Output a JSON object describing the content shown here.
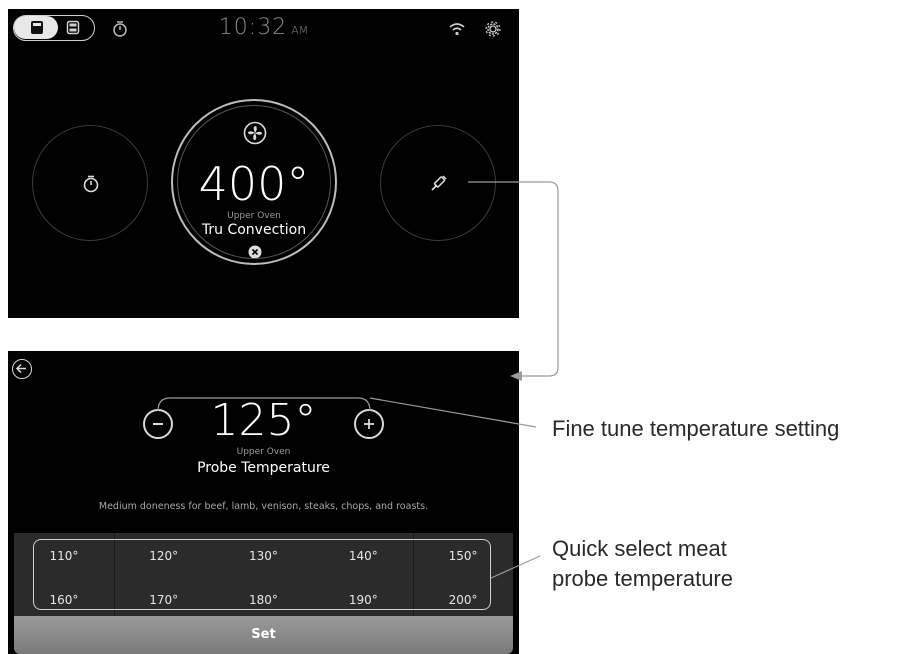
{
  "top_screen": {
    "status_bar": {
      "time": "10:32",
      "ampm": "AM"
    },
    "center_dial": {
      "temperature": "400°",
      "oven_label": "Upper Oven",
      "mode": "Tru Convection"
    },
    "icons": {
      "left_dial": "timer-icon",
      "right_dial": "probe-icon",
      "center_top": "fan-icon",
      "center_bottom": "cancel-icon",
      "status_left": "upper-oven-icon",
      "status_right": "lower-oven-icon",
      "status_timer": "timer-icon",
      "status_wifi": "wifi-icon",
      "status_settings": "gear-icon"
    }
  },
  "bottom_screen": {
    "temperature": "125°",
    "oven_label": "Upper Oven",
    "mode": "Probe Temperature",
    "description": "Medium doneness for beef, lamb, venison, steaks, chops, and roasts.",
    "quick_select": {
      "row1": [
        "110°",
        "120°",
        "130°",
        "140°",
        "150°"
      ],
      "row2": [
        "160°",
        "170°",
        "180°",
        "190°",
        "200°"
      ]
    },
    "set_label": "Set",
    "icons": {
      "back": "back-arrow-icon",
      "minus": "minus-icon",
      "plus": "plus-icon"
    }
  },
  "annotations": {
    "fine_tune": "Fine tune temperature setting",
    "quick_select_line1": "Quick select meat",
    "quick_select_line2": "probe temperature"
  },
  "colors": {
    "screen_bg": "#000000",
    "grid_bg": "#2b2b2b",
    "set_bar": "#8a8a8a",
    "annotation_line": "#9a9a9a"
  }
}
